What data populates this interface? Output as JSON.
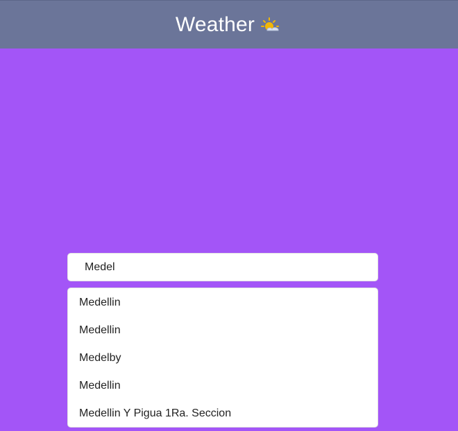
{
  "header": {
    "title": "Weather",
    "icon": "sun-behind-cloud-icon"
  },
  "search": {
    "value": "Medel",
    "placeholder": ""
  },
  "results": [
    {
      "label": "Medellin"
    },
    {
      "label": "Medellin"
    },
    {
      "label": "Medelby"
    },
    {
      "label": "Medellin"
    },
    {
      "label": "Medellin Y Pigua 1Ra. Seccion"
    }
  ],
  "colors": {
    "background": "#a355f7",
    "header": "#6b7599",
    "panel": "#ffffff",
    "text": "#222222"
  }
}
